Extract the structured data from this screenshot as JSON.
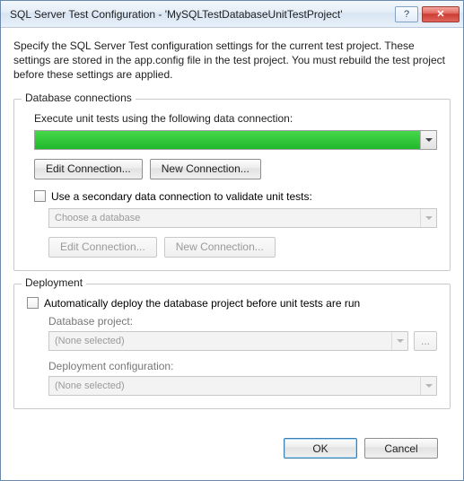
{
  "window": {
    "title": "SQL Server Test Configuration - 'MySQLTestDatabaseUnitTestProject'",
    "help_icon": "?",
    "close_icon": "✕"
  },
  "intro": "Specify the SQL Server Test configuration settings for the current test project. These settings are stored in the app.config file in the test project. You must rebuild the test project before these settings are applied.",
  "db": {
    "legend": "Database connections",
    "primary_label": "Execute unit tests using the following data connection:",
    "primary_value": "",
    "edit_btn": "Edit Connection...",
    "new_btn": "New Connection...",
    "secondary_check_label": "Use a secondary data connection to validate unit tests:",
    "secondary_placeholder": "Choose a database",
    "secondary_edit_btn": "Edit Connection...",
    "secondary_new_btn": "New Connection..."
  },
  "deploy": {
    "legend": "Deployment",
    "auto_check_label": "Automatically deploy the database project before unit tests are run",
    "project_label": "Database project:",
    "project_value": "(None selected)",
    "browse": "...",
    "config_label": "Deployment configuration:",
    "config_value": "(None selected)"
  },
  "footer": {
    "ok": "OK",
    "cancel": "Cancel"
  }
}
